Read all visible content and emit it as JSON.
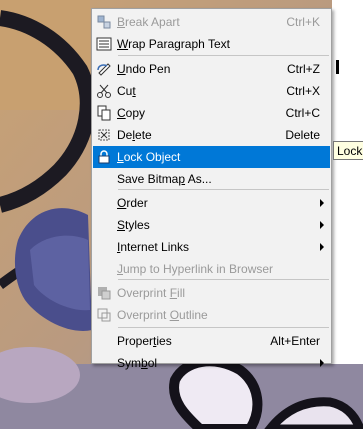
{
  "menu": {
    "items": [
      {
        "id": "break-apart",
        "pre": "",
        "acc": "B",
        "post": "reak Apart",
        "shortcut": "Ctrl+K",
        "disabled": true,
        "icon": "break-apart-icon"
      },
      {
        "id": "wrap-paragraph",
        "pre": "",
        "acc": "W",
        "post": "rap Paragraph Text",
        "shortcut": "",
        "disabled": false,
        "icon": "wrap-paragraph-icon"
      },
      {
        "id": "undo-pen",
        "pre": "",
        "acc": "U",
        "post": "ndo Pen",
        "shortcut": "Ctrl+Z",
        "disabled": false,
        "icon": "undo-pen-icon"
      },
      {
        "id": "cut",
        "pre": "Cu",
        "acc": "t",
        "post": "",
        "shortcut": "Ctrl+X",
        "disabled": false,
        "icon": "scissors-icon"
      },
      {
        "id": "copy",
        "pre": "",
        "acc": "C",
        "post": "opy",
        "shortcut": "Ctrl+C",
        "disabled": false,
        "icon": "copy-icon"
      },
      {
        "id": "delete",
        "pre": "De",
        "acc": "l",
        "post": "ete",
        "shortcut": "Delete",
        "disabled": false,
        "icon": "delete-icon"
      },
      {
        "id": "lock-object",
        "pre": "",
        "acc": "L",
        "post": "ock Object",
        "shortcut": "",
        "disabled": false,
        "icon": "lock-icon"
      },
      {
        "id": "save-bitmap",
        "pre": "Save Bitma",
        "acc": "p",
        "post": " As...",
        "shortcut": "",
        "disabled": false,
        "icon": ""
      },
      {
        "id": "order",
        "pre": "",
        "acc": "O",
        "post": "rder",
        "shortcut": "",
        "disabled": false,
        "icon": "",
        "submenu": true
      },
      {
        "id": "styles",
        "pre": "",
        "acc": "S",
        "post": "tyles",
        "shortcut": "",
        "disabled": false,
        "icon": "",
        "submenu": true
      },
      {
        "id": "internet-links",
        "pre": "",
        "acc": "I",
        "post": "nternet Links",
        "shortcut": "",
        "disabled": false,
        "icon": "",
        "submenu": true
      },
      {
        "id": "jump-hyperlink",
        "pre": "",
        "acc": "J",
        "post": "ump to Hyperlink in Browser",
        "shortcut": "",
        "disabled": true,
        "icon": ""
      },
      {
        "id": "overprint-fill",
        "pre": "Overprint ",
        "acc": "F",
        "post": "ill",
        "shortcut": "",
        "disabled": true,
        "icon": "overprint-fill-icon"
      },
      {
        "id": "overprint-outline",
        "pre": "Overprint ",
        "acc": "O",
        "post": "utline",
        "shortcut": "",
        "disabled": true,
        "icon": "overprint-outline-icon"
      },
      {
        "id": "properties",
        "pre": "Proper",
        "acc": "t",
        "post": "ies",
        "shortcut": "Alt+Enter",
        "disabled": false,
        "icon": ""
      },
      {
        "id": "symbol",
        "pre": "Sym",
        "acc": "b",
        "post": "ol",
        "shortcut": "",
        "disabled": false,
        "icon": "",
        "submenu": true
      }
    ],
    "highlighted": "lock-object"
  },
  "tooltip": {
    "text": "Lock"
  },
  "colors": {
    "highlight": "#0078d7",
    "menu_bg": "#f2f2f2",
    "disabled_text": "#9a9a9a",
    "tooltip_bg": "#ffffe1"
  }
}
